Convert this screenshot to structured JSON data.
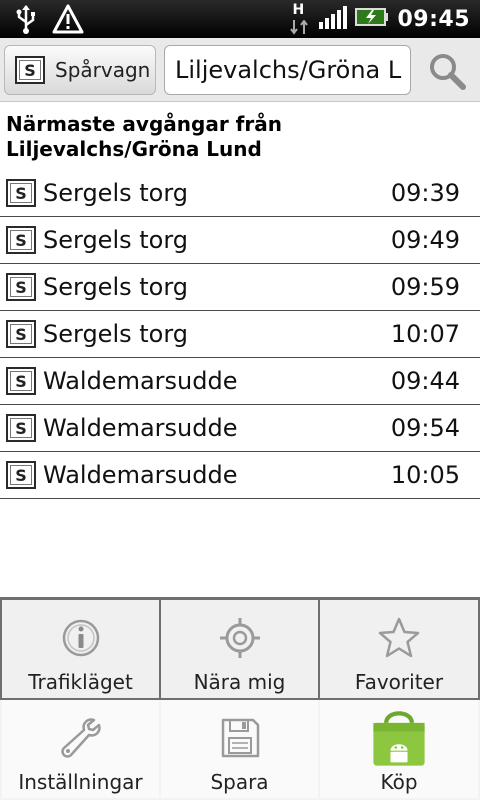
{
  "status_bar": {
    "icons": [
      "usb-icon",
      "warning-icon",
      "hsdpa-icon",
      "signal-icon",
      "battery-charging-icon"
    ],
    "network_label": "H",
    "time": "09:45"
  },
  "toolbar": {
    "mode_label": "Spårvagn",
    "mode_icon": "tram-s-icon",
    "stop_value": "Liljevalchs/Gröna L",
    "search_icon": "search-icon"
  },
  "heading": "Närmaste avgångar från Liljevalchs/Gröna Lund",
  "departures": [
    {
      "destination": "Sergels torg",
      "time": "09:39"
    },
    {
      "destination": "Sergels torg",
      "time": "09:49"
    },
    {
      "destination": "Sergels torg",
      "time": "09:59"
    },
    {
      "destination": "Sergels torg",
      "time": "10:07"
    },
    {
      "destination": "Waldemarsudde",
      "time": "09:44"
    },
    {
      "destination": "Waldemarsudde",
      "time": "09:54"
    },
    {
      "destination": "Waldemarsudde",
      "time": "10:05"
    }
  ],
  "menu": {
    "items": [
      {
        "label": "Trafikläget",
        "icon": "info-icon"
      },
      {
        "label": "Nära mig",
        "icon": "crosshair-icon"
      },
      {
        "label": "Favoriter",
        "icon": "star-icon"
      },
      {
        "label": "Inställningar",
        "icon": "wrench-icon"
      },
      {
        "label": "Spara",
        "icon": "save-disk-icon"
      },
      {
        "label": "Köp",
        "icon": "market-bag-icon"
      }
    ]
  }
}
